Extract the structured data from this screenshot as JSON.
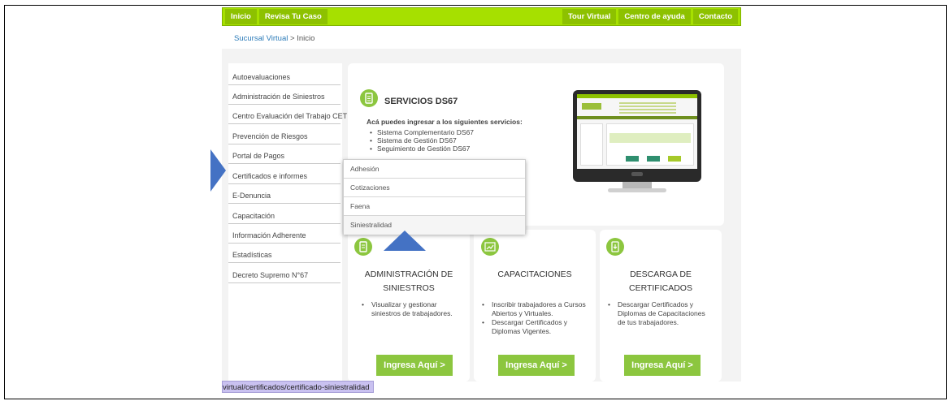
{
  "nav": {
    "left": [
      "Inicio",
      "Revisa Tu Caso"
    ],
    "right": [
      "Tour Virtual",
      "Centro de ayuda",
      "Contacto"
    ]
  },
  "breadcrumb": {
    "link": "Sucursal Virtual",
    "separator": " > ",
    "current": "Inicio"
  },
  "sidebar": {
    "items": [
      "Autoevaluaciones",
      "Administración de Siniestros",
      "Centro Evaluación del Trabajo CET",
      "Prevención de Riesgos",
      "Portal de Pagos",
      "Certificados e informes",
      "E-Denuncia",
      "Capacitación",
      "Información Adherente",
      "Estadísticas",
      "Decreto Supremo N°67"
    ]
  },
  "services": {
    "title": "SERVICIOS DS67",
    "subtitle": "Acá puedes ingresar a los siguientes servicios:",
    "items": [
      "Sistema Complementario DS67",
      "Sistema de Gestión DS67",
      "Seguimiento de Gestión DS67"
    ]
  },
  "dropdown": {
    "items": [
      "Adhesión",
      "Cotizaciones",
      "Faena",
      "Siniestralidad"
    ]
  },
  "cards": [
    {
      "title_line1": "ADMINISTRACIÓN DE",
      "title_line2": "SINIESTROS",
      "items": [
        "Visualizar y gestionar siniestros de trabajadores."
      ],
      "button": "Ingresa Aquí >"
    },
    {
      "title_line1": "CAPACITACIONES",
      "title_line2": "",
      "items": [
        "Inscribir trabajadores a Cursos Abiertos y Virtuales.",
        "Descargar Certificados y Diplomas Vigentes."
      ],
      "button": "Ingresa Aquí >"
    },
    {
      "title_line1": "DESCARGA DE",
      "title_line2": "CERTIFICADOS",
      "items": [
        "Descargar Certificados y Diplomas de Capacitaciones de tus trabajadores."
      ],
      "button": "Ingresa Aquí >"
    }
  ],
  "status_url": "virtual/certificados/certificado-siniestralidad",
  "icons": {
    "services": "document-icon",
    "card1": "document-icon",
    "card2": "chart-icon",
    "card3": "download-icon"
  },
  "colors": {
    "accent": "#a6e000",
    "button": "#8cc63f",
    "annotation": "#4472c4"
  }
}
